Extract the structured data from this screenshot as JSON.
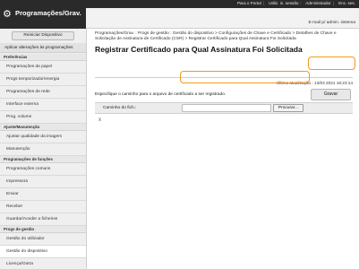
{
  "header": {
    "app_title": "Programações/Grav.",
    "top_links": [
      "Para o Portal",
      "Utiliz. in. sessão :",
      "Administrador",
      "Enc. ses."
    ],
    "email_link": "E-mail p/ admin. sistema",
    "bar_color": "#2a2a2a"
  },
  "sidebar": {
    "restart_label": "Reiniciar Dispositivo",
    "apply_label": "Aplicar alterações às programações",
    "sections": [
      {
        "title": "Preferências",
        "items": [
          {
            "label": "Programações de papel",
            "active": false
          },
          {
            "label": "Progs temporizador/energia",
            "active": false
          },
          {
            "label": "Programações de rede",
            "active": false
          },
          {
            "label": "Interface externa",
            "active": false
          },
          {
            "label": "Prog. volume",
            "active": false
          }
        ]
      },
      {
        "title": "Ajuste/Manutenção",
        "items": [
          {
            "label": "Ajustar qualidade da imagem",
            "active": false
          },
          {
            "label": "Manutenção",
            "active": false
          }
        ]
      },
      {
        "title": "Programações de funções",
        "items": [
          {
            "label": "Programações comuns",
            "active": false
          },
          {
            "label": "Impressora",
            "active": false
          },
          {
            "label": "Enviar",
            "active": false
          },
          {
            "label": "Receber",
            "active": false
          },
          {
            "label": "Guardar/Aceder a ficheiros",
            "active": false
          }
        ]
      },
      {
        "title": "Progs de gestão",
        "items": [
          {
            "label": "Gestão do utilizador",
            "active": false
          },
          {
            "label": "Gestão do dispositivo",
            "active": true
          },
          {
            "label": "Licença/Outra",
            "active": false
          }
        ]
      }
    ]
  },
  "main": {
    "breadcrumb": "Programações/Grav. : Progs de gestão : Gestão do dispositivo > Configurações de Chave e Certificado > Detalhes de Chave e Solicitação de Assinatura de Certificado (CSR) > Registrar Certificado para Qual Assinatura Foi Solicitada",
    "page_title": "Registrar Certificado para Qual Assinatura Foi Solicitada",
    "last_update": "Última atualização : 13/03 2021 16:23:14",
    "instruction": "Especifique o caminho para o arquivo de certificado a ser registrado.",
    "save_label": "Gravar",
    "file_path_label": "Caminho do fich.:",
    "file_path_value": "",
    "browse_label": "Procurar...",
    "clear_symbol": "x",
    "highlight_color": "#f29a1a"
  }
}
